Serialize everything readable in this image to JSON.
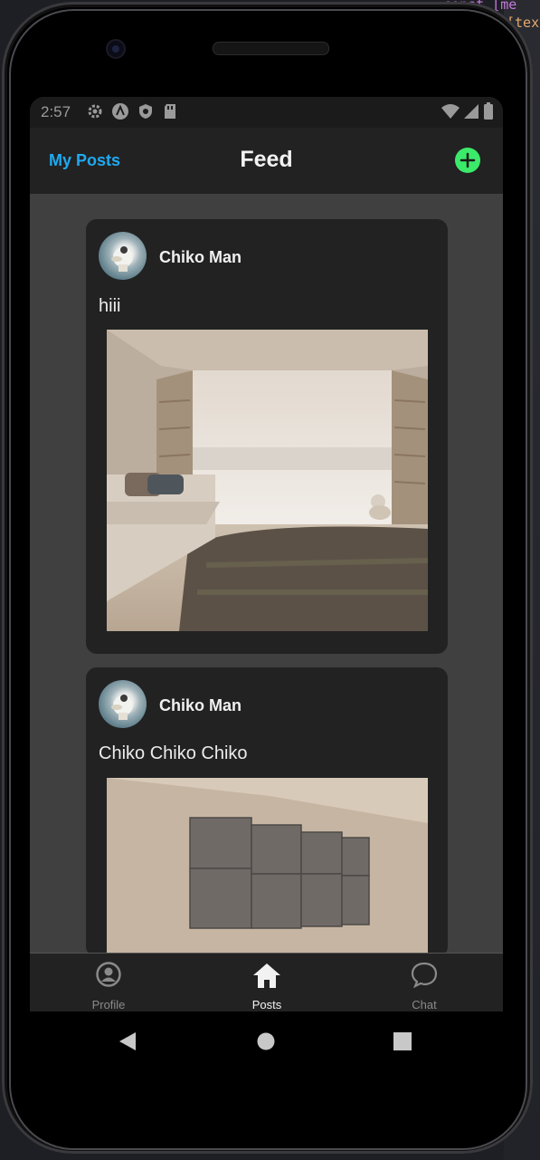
{
  "background_editor": {
    "fragments": [
      "const [me",
      "[tex"
    ]
  },
  "status_bar": {
    "time": "2:57",
    "left_icons": [
      "gear-icon",
      "a-icon",
      "shield-icon",
      "sdcard-icon"
    ],
    "right_icons": [
      "wifi-icon",
      "signal-icon",
      "battery-icon"
    ]
  },
  "header": {
    "my_posts_label": "My Posts",
    "title": "Feed",
    "add_icon": "plus-circle-icon",
    "accent_color": "#1eaaf1",
    "add_color": "#3bea6a"
  },
  "posts": [
    {
      "author": "Chiko Man",
      "text": "hiii",
      "image": "living room with sofa, bookshelves, rug and a dog by a large window"
    },
    {
      "author": "Chiko Man",
      "text": "Chiko Chiko Chiko",
      "image": "room with grey acoustic wall panels under a sloped ceiling"
    }
  ],
  "bottom_nav": {
    "items": [
      {
        "label": "Profile",
        "icon": "profile-icon",
        "active": false
      },
      {
        "label": "Posts",
        "icon": "home-icon",
        "active": true
      },
      {
        "label": "Chat",
        "icon": "chat-icon",
        "active": false
      }
    ]
  },
  "system_nav": [
    "back-icon",
    "home-circle-icon",
    "recents-icon"
  ]
}
